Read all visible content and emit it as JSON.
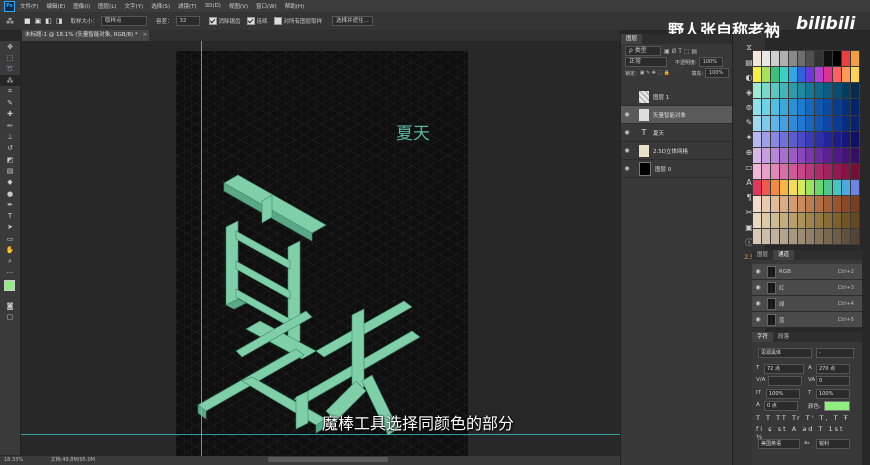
{
  "menu": {
    "app_badge": "Ps",
    "items": [
      "文件(F)",
      "编辑(E)",
      "图像(I)",
      "图层(L)",
      "文字(Y)",
      "选择(S)",
      "滤镜(T)",
      "3D(D)",
      "视图(V)",
      "窗口(W)",
      "帮助(H)"
    ]
  },
  "options": {
    "sample_size_label": "取样大小：",
    "sample_size_value": "取样点",
    "tolerance_label": "容差：",
    "tolerance_value": "32",
    "antialias_label": "消除锯齿",
    "contiguous_label": "连续",
    "all_layers_label": "对所有图层取样",
    "select_subject_label": "选择并遮住..."
  },
  "watermark": {
    "text": "野人张自称老衲",
    "logo": "bilibili"
  },
  "document": {
    "tab_title": "未标题-1 @ 18.1% (矢量智能对象, RGB/8) *",
    "small_title": "夏天",
    "subtitle": "魔棒工具选择同颜色的部分",
    "background_color": "#0f0f0f",
    "guide_color": "#3fd5d5",
    "text_color": "#7fcfa9"
  },
  "status": {
    "zoom": "18.33%",
    "doc_info": "文档:49.8M/95.0M"
  },
  "layers_panel": {
    "tabs": [
      "图层",
      "通道",
      "路径"
    ],
    "kind_label": "ρ 类型",
    "blend_mode": "正常",
    "opacity_label": "不透明度:",
    "opacity_value": "100%",
    "lock_label": "锁定:",
    "fill_label": "填充:",
    "fill_value": "100%",
    "layers": [
      {
        "name": "图层 1",
        "visible": false,
        "selected": false
      },
      {
        "name": "矢量智能对象",
        "visible": true,
        "selected": true
      },
      {
        "name": "夏天",
        "visible": true,
        "selected": false,
        "type": "text"
      },
      {
        "name": "2.5D立体网格",
        "visible": true,
        "selected": false
      },
      {
        "name": "图层 0",
        "visible": true,
        "selected": false
      }
    ]
  },
  "channels_panel": {
    "tabs": [
      "图层",
      "通道"
    ],
    "rows": [
      {
        "name": "RGB",
        "key": "Ctrl+2"
      },
      {
        "name": "红",
        "key": "Ctrl+3"
      },
      {
        "name": "绿",
        "key": "Ctrl+4"
      },
      {
        "name": "蓝",
        "key": "Ctrl+5"
      }
    ]
  },
  "character_panel": {
    "tabs": [
      "字符",
      "段落"
    ],
    "font_family": "思源黑体",
    "font_style": "-",
    "font_size": "72 点",
    "leading": "270 点",
    "tracking": "0",
    "vertical_scale": "100%",
    "horizontal_scale": "100%",
    "baseline": "0 点",
    "color_label": "颜色:",
    "text_color": "#8fee7f",
    "language": "美国英语",
    "antialias": "锐利"
  },
  "side_number": "2.5",
  "swatch_colors": [
    "#f2e7d8",
    "#e7e7e7",
    "#cfcfcf",
    "#b0b0b0",
    "#8a8a8a",
    "#6e6e6e",
    "#4f4f4f",
    "#333",
    "#111",
    "#000",
    "#e84040",
    "#f0a040",
    "#f7f042",
    "#a6e05c",
    "#39c07a",
    "#3ad0c8",
    "#30a8e8",
    "#2e64d8",
    "#6a3ad8",
    "#b040d0",
    "#e03090",
    "#ff6060",
    "#ff9a55",
    "#ffd25a",
    "#9fe8d2",
    "#7cd8c8",
    "#5ec6c0",
    "#45b4b6",
    "#309aa8",
    "#2088a0",
    "#147898",
    "#0d6a8c",
    "#0a5c80",
    "#084c70",
    "#063c5e",
    "#042c4c",
    "#8fe0e8",
    "#70d0e4",
    "#52bee0",
    "#3aa8dc",
    "#2a92d4",
    "#1e7ccc",
    "#1468c0",
    "#0e58b0",
    "#0a4aa0",
    "#083c8e",
    "#06307c",
    "#04246a",
    "#a0d8f0",
    "#80c8ec",
    "#60b4e8",
    "#44a0e2",
    "#308cda",
    "#2078d0",
    "#1866c4",
    "#1256b6",
    "#0e48a6",
    "#0a3a94",
    "#082e82",
    "#062270",
    "#b8b8f0",
    "#a0a0e8",
    "#8888e0",
    "#7070d8",
    "#5c5cce",
    "#4a4ac2",
    "#3a3ab6",
    "#2e2ea8",
    "#24249a",
    "#1c1c8a",
    "#16167a",
    "#10106a",
    "#d8b8e8",
    "#c8a0e0",
    "#b888d8",
    "#a870ce",
    "#985cc4",
    "#8848b8",
    "#7838ac",
    "#6a2ca0",
    "#5c2292",
    "#4e1a84",
    "#421476",
    "#360e68",
    "#f0b8d8",
    "#e8a0c8",
    "#e088b8",
    "#d870a8",
    "#ce5a98",
    "#c44888",
    "#b83878",
    "#ac2c6a",
    "#a0225c",
    "#921a50",
    "#841444",
    "#760e38",
    "#e0385a",
    "#ef5a50",
    "#f28a40",
    "#f5b642",
    "#f7dc58",
    "#d6ea5e",
    "#9ee260",
    "#6ad66c",
    "#4cc88a",
    "#48c4c4",
    "#50a8e0",
    "#6c84e8",
    "#f0dcc8",
    "#e8ccb0",
    "#e0bc98",
    "#d8ac84",
    "#d09c70",
    "#c88c5e",
    "#bc7c4e",
    "#b06e42",
    "#a46038",
    "#98542e",
    "#8a4826",
    "#7c3e1e",
    "#e8d8c0",
    "#dccaa8",
    "#d0bc94",
    "#c4ae80",
    "#b8a06e",
    "#ac925e",
    "#a0844e",
    "#947842",
    "#886c38",
    "#7c602e",
    "#705426",
    "#64481e",
    "#d8c8b8",
    "#ccbcaa",
    "#c0b09c",
    "#b4a48e",
    "#a89880",
    "#9c8c74",
    "#908068",
    "#84745c",
    "#786852",
    "#6c5c48",
    "#60503e",
    "#544434"
  ]
}
